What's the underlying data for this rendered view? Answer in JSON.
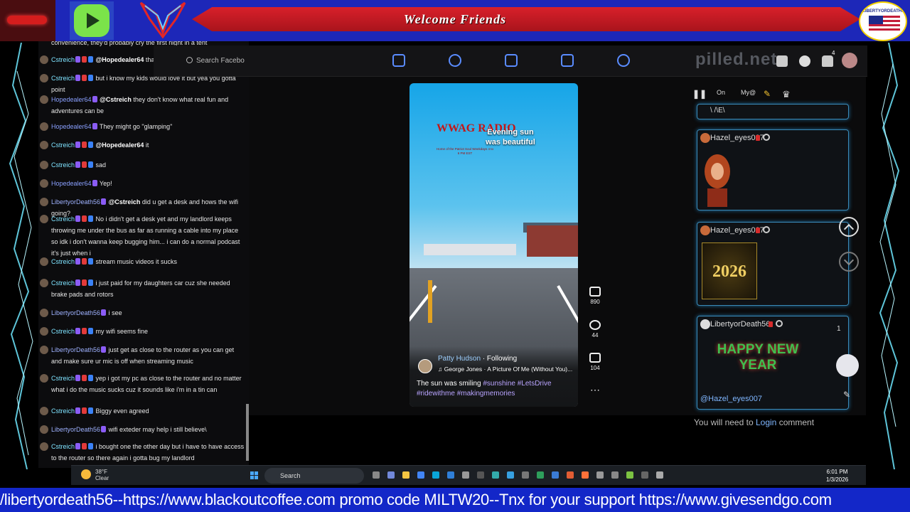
{
  "banner": {
    "title": "Welcome Friends",
    "seal_text": "LIBERTYORDEATH56"
  },
  "chat": {
    "top_partial": "convenience, they'd probably cry the first night in a tent",
    "messages": [
      {
        "user": "Cstreich",
        "type": "c",
        "mention": "@Hopedealer64",
        "text": "that's hilarious"
      },
      {
        "user": "Cstreich",
        "type": "c",
        "mention": "",
        "text": "but i know my kids would love it but yea you gotta point"
      },
      {
        "user": "Hopedealer64",
        "type": "h",
        "mention": "@Cstreich",
        "text": "they don't know what real fun and adventures can be"
      },
      {
        "user": "Hopedealer64",
        "type": "h",
        "mention": "",
        "text": "They might go \"glamping\""
      },
      {
        "user": "Cstreich",
        "type": "c",
        "mention": "@Hopedealer64",
        "text": "it"
      },
      {
        "user": "Cstreich",
        "type": "c",
        "mention": "",
        "text": "sad"
      },
      {
        "user": "Hopedealer64",
        "type": "h",
        "mention": "",
        "text": "Yep!"
      },
      {
        "user": "LibertyorDeath56",
        "type": "l",
        "mention": "@Cstreich",
        "text": "did u get a desk and hows the wifi going?"
      },
      {
        "user": "Cstreich",
        "type": "c",
        "mention": "",
        "text": "No i didn't get a desk yet and my landlord keeps throwing me under the bus as far as running a cable into my place so idk i don't wanna keep bugging him... i can do a normal podcast it's just when i"
      },
      {
        "user": "Cstreich",
        "type": "c",
        "mention": "",
        "text": "stream music videos it sucks"
      },
      {
        "user": "Cstreich",
        "type": "c",
        "mention": "",
        "text": "i just paid for my daughters car cuz she needed brake pads and rotors"
      },
      {
        "user": "LibertyorDeath56",
        "type": "l",
        "mention": "",
        "text": "i see"
      },
      {
        "user": "Cstreich",
        "type": "c",
        "mention": "",
        "text": "my wifi seems fine"
      },
      {
        "user": "LibertyorDeath56",
        "type": "l",
        "mention": "",
        "text": "just get as close to the router as you can get and make sure ur mic is off when streaming music"
      },
      {
        "user": "Cstreich",
        "type": "c",
        "mention": "",
        "text": "yep i got my pc as close to the router and no matter what i do the music sucks cuz it sounds like i'm in a tin can"
      },
      {
        "user": "Cstreich",
        "type": "c",
        "mention": "",
        "text": "Biggy even agreed"
      },
      {
        "user": "LibertyorDeath56",
        "type": "l",
        "mention": "",
        "text": "wifi exteder may help i still believe\\"
      },
      {
        "user": "Cstreich",
        "type": "c",
        "mention": "",
        "text": "i bought one the other day but i have to have access to the router so there again i gotta bug my landlord"
      }
    ]
  },
  "facebook": {
    "search_placeholder": "Search Facebo",
    "brand": "pilled.net",
    "notif_count": "4"
  },
  "reel": {
    "station": "WWAG RADIO",
    "station_sub": "Home of the Patriot Soul Weekdays 4 to 6 PM EST",
    "overlay_caption": "Evening sun was beautiful",
    "author": "Patty Hudson",
    "follow": "· Following",
    "song": "♫ George Jones · A Picture Of Me (Without You)...",
    "caption": "The sun was smiling",
    "tags": "#sunshine #LetsDrive #ridewithme #makingmemories",
    "likes": "890",
    "comments": "44",
    "shares": "104"
  },
  "right": {
    "toolbar": [
      "On",
      "My@"
    ],
    "top_partial": "\\ /\\E\\",
    "cards": [
      {
        "name": "Hazel_eyes007"
      },
      {
        "name": "Hazel_eyes007",
        "image_text": "2026"
      },
      {
        "name": "LibertyorDeath56",
        "count": "1",
        "image_text": "HAPPY NEW YEAR",
        "mention": "@Hazel_eyes007"
      }
    ],
    "login_pre": "You will need to",
    "login_link": "Login",
    "login_post": "comment"
  },
  "taskbar": {
    "temp": "38°F",
    "weather": "Clear",
    "search": "Search",
    "time": "6:01 PM",
    "date": "1/3/2026"
  },
  "ticker": "/libertyordeath56--https://www.blackoutcoffee.com promo code MILTW20--Tnx for your support https://www.givesendgo.com"
}
